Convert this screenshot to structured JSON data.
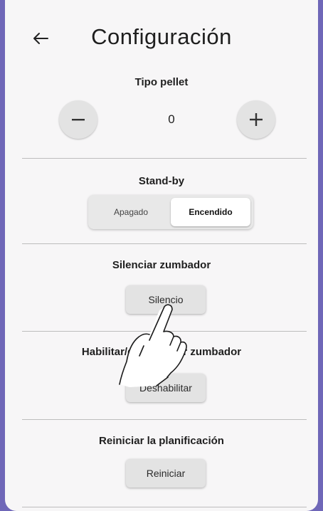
{
  "header": {
    "back_icon": "arrow-left-icon",
    "title": "Configuración"
  },
  "pellet": {
    "label": "Tipo pellet",
    "decrement_icon": "minus-icon",
    "increment_icon": "plus-icon",
    "value": "0"
  },
  "standby": {
    "label": "Stand-by",
    "options": [
      "Apagado",
      "Encendido"
    ],
    "selected": "Encendido"
  },
  "mute_buzzer": {
    "label": "Silenciar zumbador",
    "button": "Silencio"
  },
  "enable_buzzer": {
    "label": "Habilitar/deshabilitar zumbador",
    "button": "Deshabilitar"
  },
  "reset_schedule": {
    "label": "Reiniciar la planificación",
    "button": "Reiniciar"
  },
  "overlay": {
    "icon": "hand-pointer-icon"
  },
  "colors": {
    "accent_frame": "#6f67b8",
    "background": "#f7f6f7",
    "button_gray": "#e3e3e3"
  }
}
